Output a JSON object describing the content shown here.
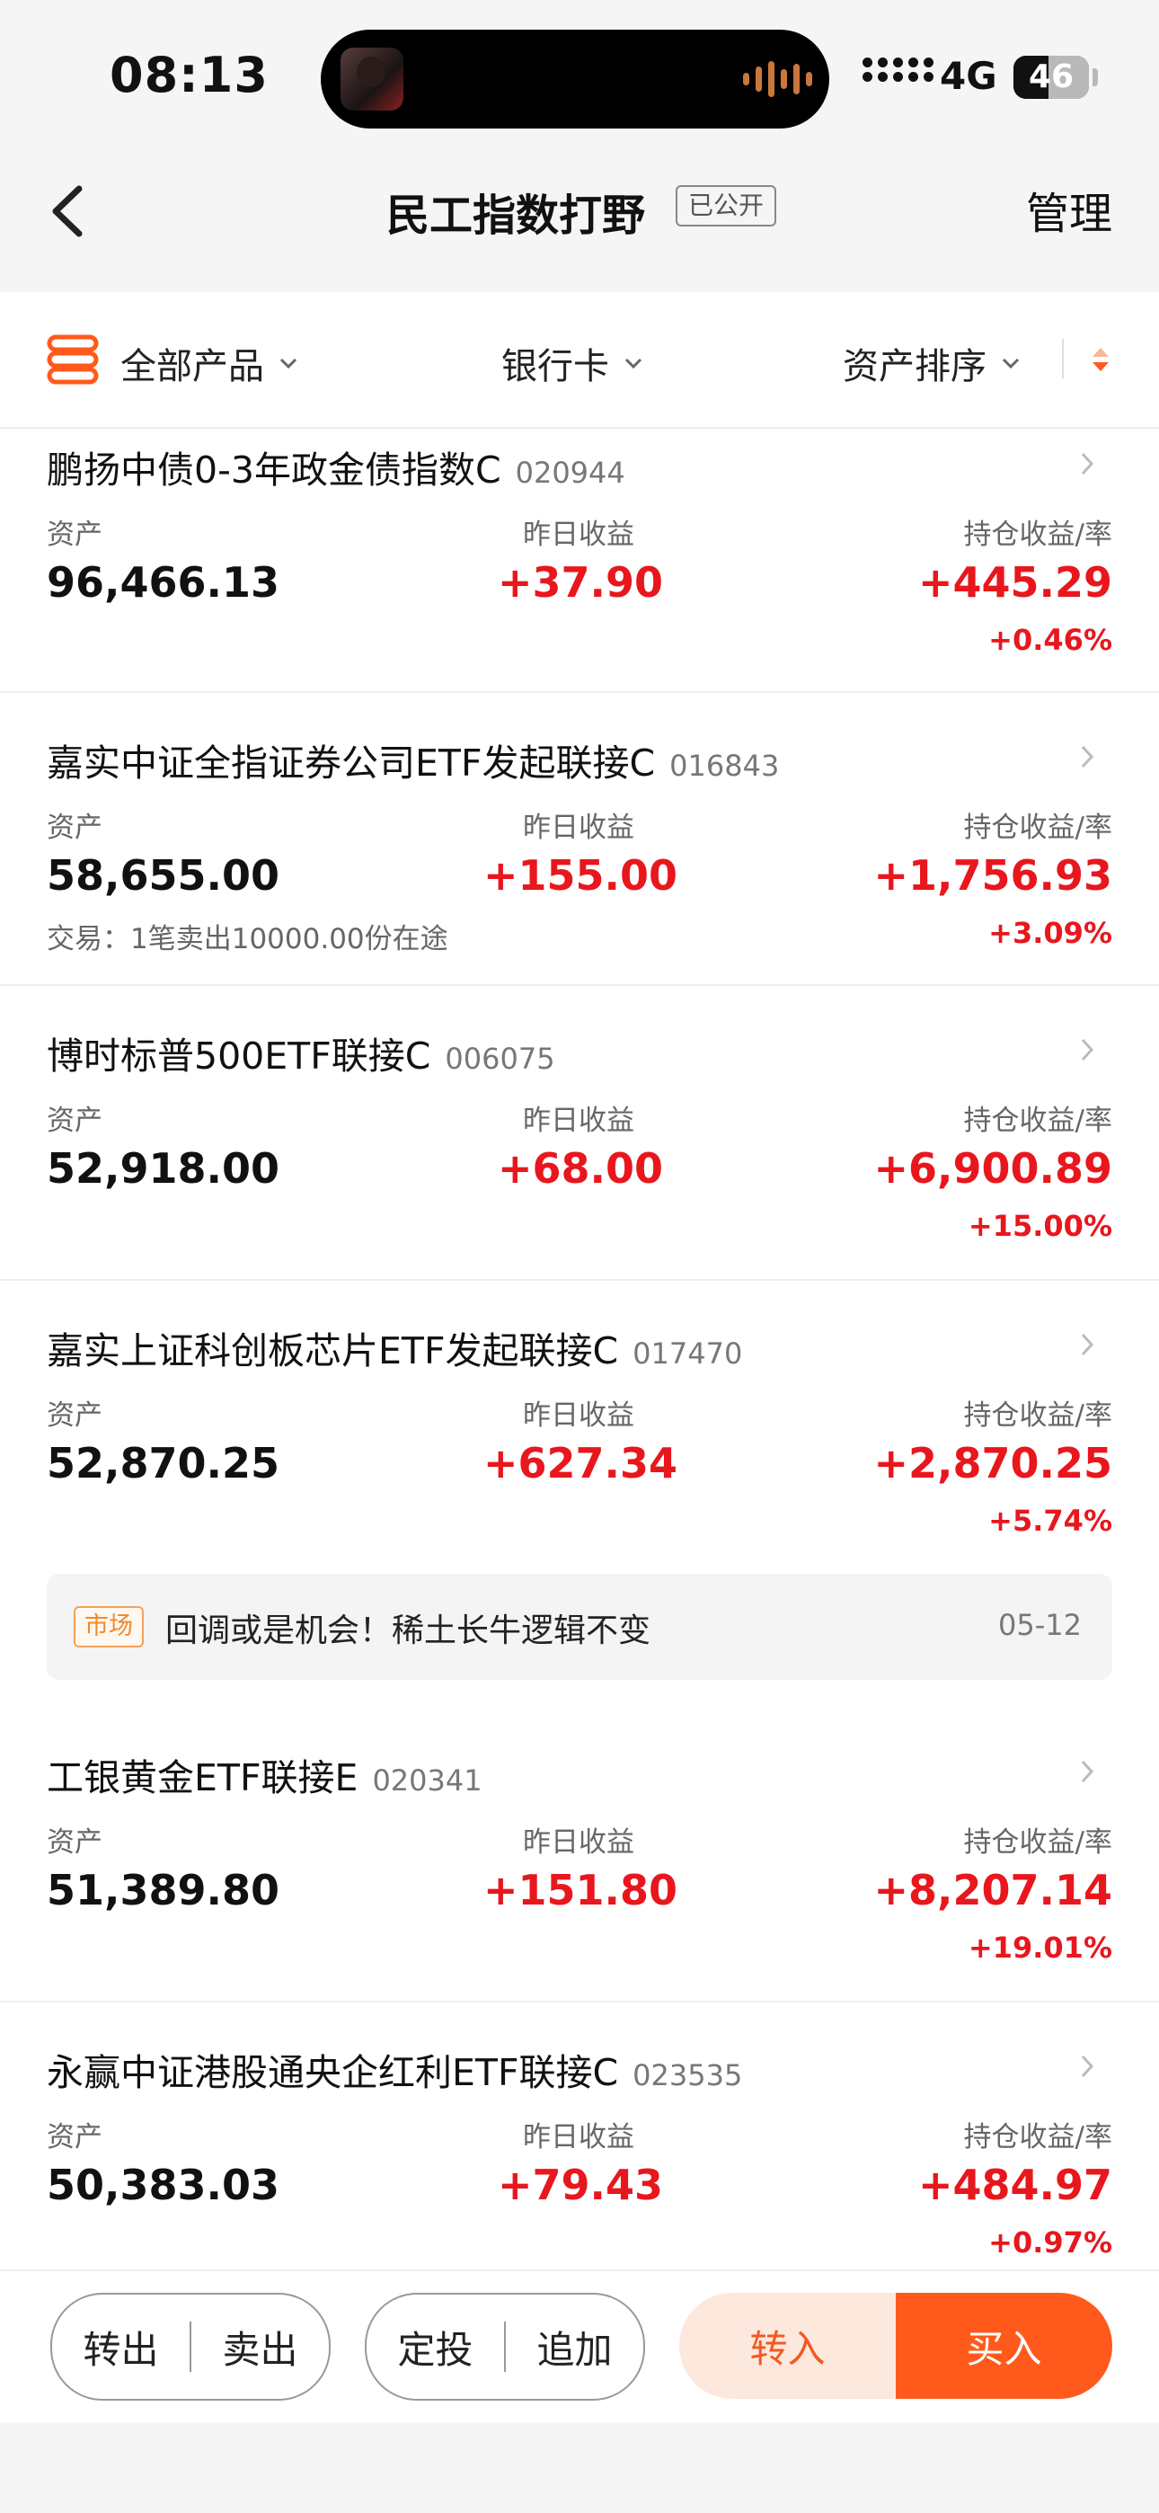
{
  "status_bar": {
    "time": "08:13",
    "network": "4G",
    "battery": "46",
    "battery_level": 0.46
  },
  "nav": {
    "title": "民工指数打野",
    "badge": "已公开",
    "manage": "管理"
  },
  "filter": {
    "products": "全部产品",
    "card": "银行卡",
    "sort": "资产排序"
  },
  "labels": {
    "asset": "资产",
    "yesterday": "昨日收益",
    "holding": "持仓收益/率"
  },
  "funds": [
    {
      "name": "鹏扬中债0-3年政金债指数C",
      "code": "020944",
      "asset": "96,466.13",
      "yesterday": "+37.90",
      "holding": "+445.29",
      "rate": "+0.46%"
    },
    {
      "name": "嘉实中证全指证券公司ETF发起联接C",
      "code": "016843",
      "asset": "58,655.00",
      "yesterday": "+155.00",
      "holding": "+1,756.93",
      "rate": "+3.09%",
      "trade": "交易：1笔卖出10000.00份在途"
    },
    {
      "name": "博时标普500ETF联接C",
      "code": "006075",
      "asset": "52,918.00",
      "yesterday": "+68.00",
      "holding": "+6,900.89",
      "rate": "+15.00%"
    },
    {
      "name": "嘉实上证科创板芯片ETF发起联接C",
      "code": "017470",
      "asset": "52,870.25",
      "yesterday": "+627.34",
      "holding": "+2,870.25",
      "rate": "+5.74%"
    },
    {
      "name": "工银黄金ETF联接E",
      "code": "020341",
      "asset": "51,389.80",
      "yesterday": "+151.80",
      "holding": "+8,207.14",
      "rate": "+19.01%"
    },
    {
      "name": "永赢中证港股通央企红利ETF联接C",
      "code": "023535",
      "asset": "50,383.03",
      "yesterday": "+79.43",
      "holding": "+484.97",
      "rate": "+0.97%"
    }
  ],
  "news": {
    "tag": "市场",
    "text": "回调或是机会！稀土长牛逻辑不变",
    "date": "05-12"
  },
  "actions": {
    "transfer_out": "转出",
    "sell": "卖出",
    "auto_invest": "定投",
    "add": "追加",
    "transfer_in": "转入",
    "buy": "买入"
  },
  "colors": {
    "gain_red": "#e8171d",
    "accent_orange": "#ff5a1b",
    "news_tag": "#f08a2c"
  }
}
